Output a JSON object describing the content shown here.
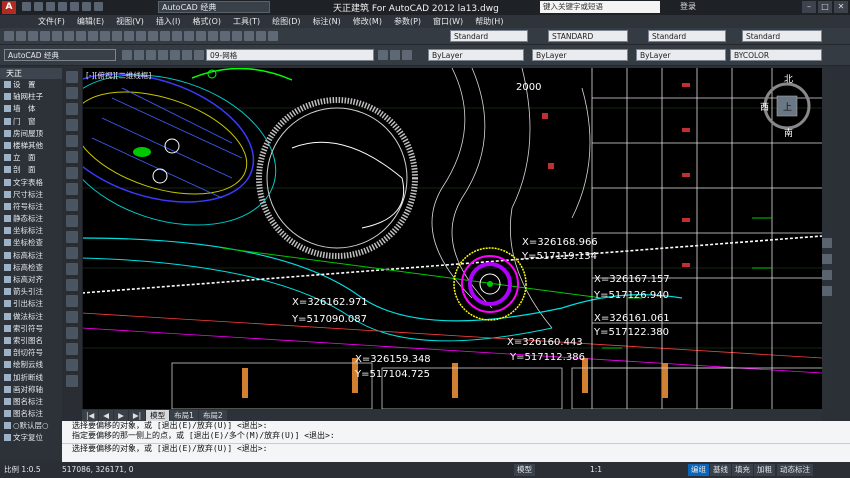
{
  "titlebar": {
    "app_icon": "A",
    "workspace": "AutoCAD 经典",
    "title": "天正建筑 For AutoCAD 2012    la13.dwg",
    "search_placeholder": "键入关键字或短语",
    "login": "登录",
    "min": "–",
    "max": "□",
    "close": "✕"
  },
  "menu": [
    "文件(F)",
    "编辑(E)",
    "视图(V)",
    "插入(I)",
    "格式(O)",
    "工具(T)",
    "绘图(D)",
    "标注(N)",
    "修改(M)",
    "参数(P)",
    "窗口(W)",
    "帮助(H)"
  ],
  "toolbar2": {
    "text_style": "Standard",
    "dim_style": "STANDARD",
    "table_style": "Standard",
    "mleader_style": "Standard"
  },
  "toolbar3": {
    "workspace": "AutoCAD 经典",
    "layer": "09-网格",
    "color": "ByLayer",
    "linetype": "ByLayer",
    "lineweight": "ByLayer",
    "plotstyle": "BYCOLOR"
  },
  "left_panel": {
    "title": "天正",
    "items": [
      "设　置",
      "轴网柱子",
      "墙　体",
      "门　窗",
      "房间屋顶",
      "楼梯其他",
      "立　面",
      "剖　面",
      "文字表格",
      "尺寸标注",
      "符号标注",
      "静态标注",
      "坐标标注",
      "坐标检查",
      "标高标注",
      "标高检查",
      "标高对齐",
      "箭头引注",
      "引出标注",
      "做法标注",
      "索引符号",
      "索引图名",
      "剖切符号",
      "绘制云线",
      "加折断线",
      "画对称轴",
      "图名标注",
      "图名标注",
      "○默认层○",
      "文字复位"
    ]
  },
  "viewport_label": "[-][俯视][二维线框]",
  "compass": {
    "north": "北",
    "south": "南",
    "west": "西",
    "east": "东",
    "top": "上"
  },
  "drawing_text": [
    {
      "text": "2000"
    },
    {
      "text": "X=326168.966"
    },
    {
      "text": "Y=517119.134"
    },
    {
      "text": "X=326167.157"
    },
    {
      "text": "Y=517126.940"
    },
    {
      "text": "X=326161.061"
    },
    {
      "text": "Y=517122.380"
    },
    {
      "text": "X=326162.971"
    },
    {
      "text": "Y=517090.087"
    },
    {
      "text": "X=326160.443"
    },
    {
      "text": "Y=517112.386"
    },
    {
      "text": "X=326159.348"
    },
    {
      "text": "Y=517104.725"
    }
  ],
  "layout_tabs": [
    "模型",
    "布局1",
    "布局2"
  ],
  "command": {
    "line1": "选择要偏移的对象，或 [退出(E)/放弃(U)] <退出>:",
    "line2": "指定要偏移的那一侧上的点，或 [退出(E)/多个(M)/放弃(U)] <退出>:",
    "line3": "选择要偏移的对象，或 [退出(E)/放弃(U)] <退出>:"
  },
  "status": {
    "scale": "比例 1:0.5",
    "coords": "517086, 326171, 0",
    "model": "模型",
    "annotation_scale": "1:1",
    "buttons": [
      "编组",
      "基线",
      "填充",
      "加粗",
      "动态标注"
    ]
  }
}
